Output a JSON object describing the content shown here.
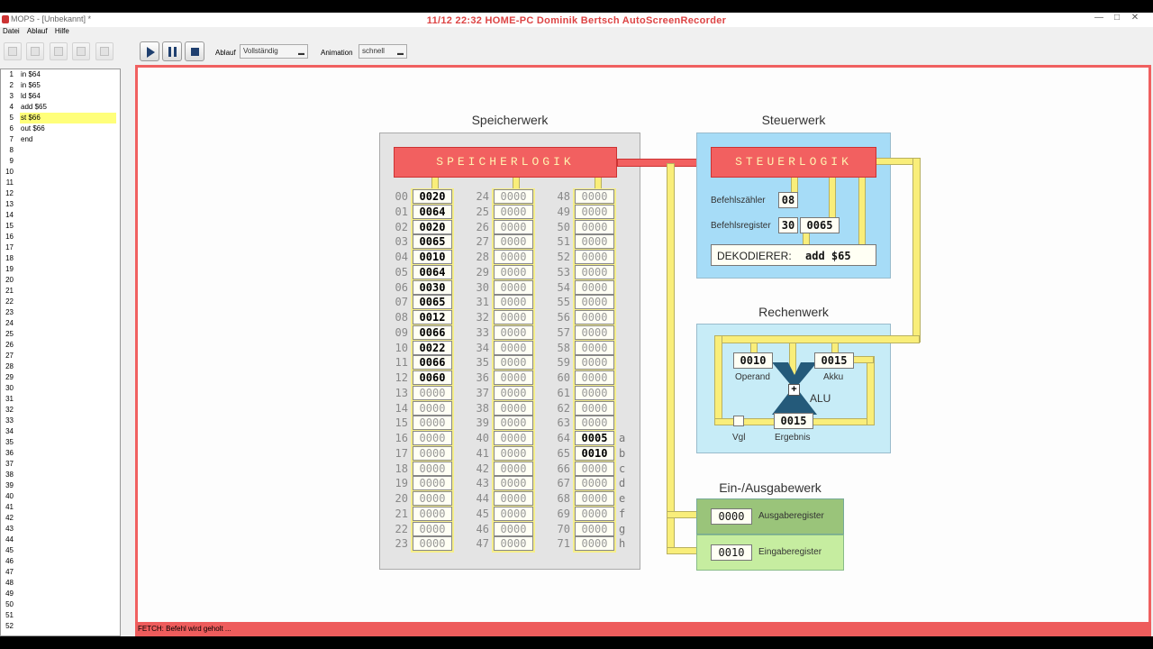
{
  "window": {
    "app_title": "MOPS - [Unbekannt] *",
    "overlay_title": "11/12  22:32  HOME-PC  Dominik Bertsch  AutoScreenRecorder",
    "minimize": "—",
    "maximize": "□",
    "close": "✕"
  },
  "menu": [
    "Datei",
    "Ablauf",
    "Hilfe"
  ],
  "toolbar": {
    "ablauf_label": "Ablauf",
    "ablauf_value": "Vollständig",
    "animation_label": "Animation",
    "animation_value": "schnell"
  },
  "editor": {
    "lines": [
      {
        "n": "1",
        "t": "in $64"
      },
      {
        "n": "2",
        "t": "in $65"
      },
      {
        "n": "3",
        "t": "ld $64"
      },
      {
        "n": "4",
        "t": "add $65"
      },
      {
        "n": "5",
        "t": "st $66",
        "hl": true
      },
      {
        "n": "6",
        "t": "out $66"
      },
      {
        "n": "7",
        "t": "end"
      },
      {
        "n": "8",
        "t": ""
      },
      {
        "n": "9",
        "t": ""
      },
      {
        "n": "10",
        "t": ""
      },
      {
        "n": "11",
        "t": ""
      },
      {
        "n": "12",
        "t": ""
      },
      {
        "n": "13",
        "t": ""
      },
      {
        "n": "14",
        "t": ""
      },
      {
        "n": "15",
        "t": ""
      },
      {
        "n": "16",
        "t": ""
      },
      {
        "n": "17",
        "t": ""
      },
      {
        "n": "18",
        "t": ""
      },
      {
        "n": "19",
        "t": ""
      },
      {
        "n": "20",
        "t": ""
      },
      {
        "n": "21",
        "t": ""
      },
      {
        "n": "22",
        "t": ""
      },
      {
        "n": "23",
        "t": ""
      },
      {
        "n": "24",
        "t": ""
      },
      {
        "n": "25",
        "t": ""
      },
      {
        "n": "26",
        "t": ""
      },
      {
        "n": "27",
        "t": ""
      },
      {
        "n": "28",
        "t": ""
      },
      {
        "n": "29",
        "t": ""
      },
      {
        "n": "30",
        "t": ""
      },
      {
        "n": "31",
        "t": ""
      },
      {
        "n": "32",
        "t": ""
      },
      {
        "n": "33",
        "t": ""
      },
      {
        "n": "34",
        "t": ""
      },
      {
        "n": "35",
        "t": ""
      },
      {
        "n": "36",
        "t": ""
      },
      {
        "n": "37",
        "t": ""
      },
      {
        "n": "38",
        "t": ""
      },
      {
        "n": "39",
        "t": ""
      },
      {
        "n": "40",
        "t": ""
      },
      {
        "n": "41",
        "t": ""
      },
      {
        "n": "42",
        "t": ""
      },
      {
        "n": "43",
        "t": ""
      },
      {
        "n": "44",
        "t": ""
      },
      {
        "n": "45",
        "t": ""
      },
      {
        "n": "46",
        "t": ""
      },
      {
        "n": "47",
        "t": ""
      },
      {
        "n": "48",
        "t": ""
      },
      {
        "n": "49",
        "t": ""
      },
      {
        "n": "50",
        "t": ""
      },
      {
        "n": "51",
        "t": ""
      },
      {
        "n": "52",
        "t": ""
      }
    ]
  },
  "speicherwerk": {
    "title": "Speicherwerk",
    "logic_label": "SPEICHERLOGIK",
    "columns": [
      {
        "addresses": [
          "00",
          "01",
          "02",
          "03",
          "04",
          "05",
          "06",
          "07",
          "08",
          "09",
          "10",
          "11",
          "12",
          "13",
          "14",
          "15",
          "16",
          "17",
          "18",
          "19",
          "20",
          "21",
          "22",
          "23"
        ],
        "values": [
          "0020",
          "0064",
          "0020",
          "0065",
          "0010",
          "0064",
          "0030",
          "0065",
          "0012",
          "0066",
          "0022",
          "0066",
          "0060",
          "0000",
          "0000",
          "0000",
          "0000",
          "0000",
          "0000",
          "0000",
          "0000",
          "0000",
          "0000",
          "0000"
        ]
      },
      {
        "addresses": [
          "24",
          "25",
          "26",
          "27",
          "28",
          "29",
          "30",
          "31",
          "32",
          "33",
          "34",
          "35",
          "36",
          "37",
          "38",
          "39",
          "40",
          "41",
          "42",
          "43",
          "44",
          "45",
          "46",
          "47"
        ],
        "values": [
          "0000",
          "0000",
          "0000",
          "0000",
          "0000",
          "0000",
          "0000",
          "0000",
          "0000",
          "0000",
          "0000",
          "0000",
          "0000",
          "0000",
          "0000",
          "0000",
          "0000",
          "0000",
          "0000",
          "0000",
          "0000",
          "0000",
          "0000",
          "0000"
        ]
      },
      {
        "addresses": [
          "48",
          "49",
          "50",
          "51",
          "52",
          "53",
          "54",
          "55",
          "56",
          "57",
          "58",
          "59",
          "60",
          "61",
          "62",
          "63",
          "64",
          "65",
          "66",
          "67",
          "68",
          "69",
          "70",
          "71"
        ],
        "values": [
          "0000",
          "0000",
          "0000",
          "0000",
          "0000",
          "0000",
          "0000",
          "0000",
          "0000",
          "0000",
          "0000",
          "0000",
          "0000",
          "0000",
          "0000",
          "0000",
          "0005",
          "0010",
          "0000",
          "0000",
          "0000",
          "0000",
          "0000",
          "0000"
        ],
        "suffixes": [
          "",
          "",
          "",
          "",
          "",
          "",
          "",
          "",
          "",
          "",
          "",
          "",
          "",
          "",
          "",
          "",
          "a",
          "b",
          "c",
          "d",
          "e",
          "f",
          "g",
          "h"
        ]
      }
    ]
  },
  "steuerwerk": {
    "title": "Steuerwerk",
    "logic_label": "STEUERLOGIK",
    "befehlszaehler_label": "Befehlszähler",
    "befehlszaehler_value": "08",
    "befehlsregister_label": "Befehlsregister",
    "befehlsregister_op": "30",
    "befehlsregister_arg": "0065",
    "dekodierer_label": "DEKODIERER:",
    "dekodierer_value": "add $65"
  },
  "rechenwerk": {
    "title": "Rechenwerk",
    "operand_value": "0010",
    "operand_label": "Operand",
    "akku_value": "0015",
    "akku_label": "Akku",
    "op_symbol": "+",
    "alu_label": "ALU",
    "ergebnis_value": "0015",
    "ergebnis_label": "Ergebnis",
    "vgl_label": "Vgl"
  },
  "io": {
    "title": "Ein-/Ausgabewerk",
    "ausgabe_value": "0000",
    "ausgabe_label": "Ausgaberegister",
    "eingabe_value": "0010",
    "eingabe_label": "Eingaberegister"
  },
  "status": "FETCH: Befehl wird geholt ...",
  "colors": {
    "logic_red": "#f26060",
    "bus_yellow": "#f9ee7a",
    "steuer_blue": "#a6dcf7",
    "rechen_blue": "#c7ecf7",
    "ausgabe_green": "#9ac47a",
    "eingabe_green": "#c6eda0",
    "memory_gray": "#e4e4e4"
  }
}
